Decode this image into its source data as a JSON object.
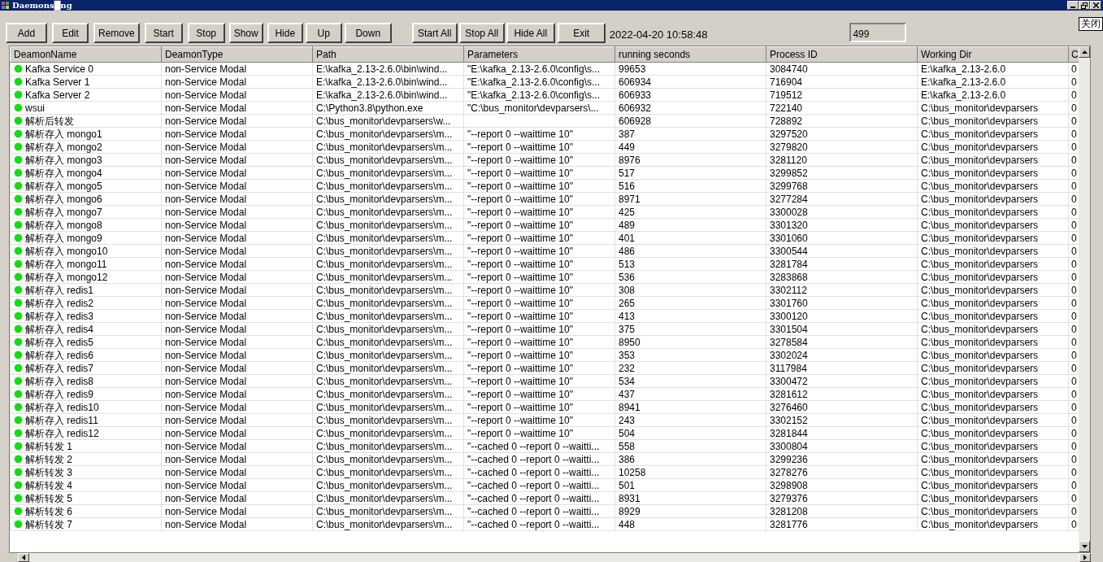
{
  "window": {
    "title": "Daemons█ng"
  },
  "toolbar": {
    "buttons": [
      "Add",
      "Edit",
      "Remove",
      "Start",
      "Stop",
      "Show",
      "Hide",
      "Up",
      "Down"
    ],
    "group_buttons": [
      "Start All",
      "Stop All",
      "Hide All",
      "Exit"
    ],
    "timestamp": "2022-04-20 10:58:48",
    "count_field": "499",
    "close_button": "关闭"
  },
  "table": {
    "columns": [
      "DeamonName",
      "DeamonType",
      "Path",
      "Parameters",
      "running seconds",
      "Process ID",
      "Working Dir",
      "C"
    ],
    "rows": [
      [
        "Kafka Service 0",
        "non-Service Modal",
        "E:\\kafka_2.13-2.6.0\\bin\\wind...",
        "\"E:\\kafka_2.13-2.6.0\\config\\s...",
        "99653",
        "3084740",
        "E:\\kafka_2.13-2.6.0",
        "0"
      ],
      [
        "Kafka Server 1",
        "non-Service Modal",
        "E:\\kafka_2.13-2.6.0\\bin\\wind...",
        "\"E:\\kafka_2.13-2.6.0\\config\\s...",
        "606934",
        "716904",
        "E:\\kafka_2.13-2.6.0",
        "0"
      ],
      [
        "Kafka Server 2",
        "non-Service Modal",
        "E:\\kafka_2.13-2.6.0\\bin\\wind...",
        "\"E:\\kafka_2.13-2.6.0\\config\\s...",
        "606933",
        "719512",
        "E:\\kafka_2.13-2.6.0",
        "0"
      ],
      [
        "wsui",
        "non-Service Modal",
        "C:\\Python3.8\\python.exe",
        "\"C:\\bus_monitor\\devparsers\\...",
        "606932",
        "722140",
        "C:\\bus_monitor\\devparsers",
        "0"
      ],
      [
        "解析后转发",
        "non-Service Modal",
        "C:\\bus_monitor\\devparsers\\w...",
        null,
        "606928",
        "728892",
        "C:\\bus_monitor\\devparsers",
        "0"
      ],
      [
        "解析存入 mongo1",
        "non-Service Modal",
        "C:\\bus_monitor\\devparsers\\m...",
        "\"--report 0 --waittime 10\"",
        "387",
        "3297520",
        "C:\\bus_monitor\\devparsers",
        "0"
      ],
      [
        "解析存入 mongo2",
        "non-Service Modal",
        "C:\\bus_monitor\\devparsers\\m...",
        "\"--report 0 --waittime 10\"",
        "449",
        "3279820",
        "C:\\bus_monitor\\devparsers",
        "0"
      ],
      [
        "解析存入 mongo3",
        "non-Service Modal",
        "C:\\bus_monitor\\devparsers\\m...",
        "\"--report 0 --waittime 10\"",
        "8976",
        "3281120",
        "C:\\bus_monitor\\devparsers",
        "0"
      ],
      [
        "解析存入 mongo4",
        "non-Service Modal",
        "C:\\bus_monitor\\devparsers\\m...",
        "\"--report 0 --waittime 10\"",
        "517",
        "3299852",
        "C:\\bus_monitor\\devparsers",
        "0"
      ],
      [
        "解析存入 mongo5",
        "non-Service Modal",
        "C:\\bus_monitor\\devparsers\\m...",
        "\"--report 0 --waittime 10\"",
        "516",
        "3299768",
        "C:\\bus_monitor\\devparsers",
        "0"
      ],
      [
        "解析存入 mongo6",
        "non-Service Modal",
        "C:\\bus_monitor\\devparsers\\m...",
        "\"--report 0 --waittime 10\"",
        "8971",
        "3277284",
        "C:\\bus_monitor\\devparsers",
        "0"
      ],
      [
        "解析存入 mongo7",
        "non-Service Modal",
        "C:\\bus_monitor\\devparsers\\m...",
        "\"--report 0 --waittime 10\"",
        "425",
        "3300028",
        "C:\\bus_monitor\\devparsers",
        "0"
      ],
      [
        "解析存入 mongo8",
        "non-Service Modal",
        "C:\\bus_monitor\\devparsers\\m...",
        "\"--report 0 --waittime 10\"",
        "489",
        "3301320",
        "C:\\bus_monitor\\devparsers",
        "0"
      ],
      [
        "解析存入 mongo9",
        "non-Service Modal",
        "C:\\bus_monitor\\devparsers\\m...",
        "\"--report 0 --waittime 10\"",
        "401",
        "3301060",
        "C:\\bus_monitor\\devparsers",
        "0"
      ],
      [
        "解析存入 mongo10",
        "non-Service Modal",
        "C:\\bus_monitor\\devparsers\\m...",
        "\"--report 0 --waittime 10\"",
        "486",
        "3300544",
        "C:\\bus_monitor\\devparsers",
        "0"
      ],
      [
        "解析存入 mongo11",
        "non-Service Modal",
        "C:\\bus_monitor\\devparsers\\m...",
        "\"--report 0 --waittime 10\"",
        "513",
        "3281784",
        "C:\\bus_monitor\\devparsers",
        "0"
      ],
      [
        "解析存入 mongo12",
        "non-Service Modal",
        "C:\\bus_monitor\\devparsers\\m...",
        "\"--report 0 --waittime 10\"",
        "536",
        "3283868",
        "C:\\bus_monitor\\devparsers",
        "0"
      ],
      [
        "解析存入 redis1",
        "non-Service Modal",
        "C:\\bus_monitor\\devparsers\\m...",
        "\"--report 0 --waittime 10\"",
        "308",
        "3302112",
        "C:\\bus_monitor\\devparsers",
        "0"
      ],
      [
        "解析存入 redis2",
        "non-Service Modal",
        "C:\\bus_monitor\\devparsers\\m...",
        "\"--report 0 --waittime 10\"",
        "265",
        "3301760",
        "C:\\bus_monitor\\devparsers",
        "0"
      ],
      [
        "解析存入 redis3",
        "non-Service Modal",
        "C:\\bus_monitor\\devparsers\\m...",
        "\"--report 0 --waittime 10\"",
        "413",
        "3300120",
        "C:\\bus_monitor\\devparsers",
        "0"
      ],
      [
        "解析存入 redis4",
        "non-Service Modal",
        "C:\\bus_monitor\\devparsers\\m...",
        "\"--report 0 --waittime 10\"",
        "375",
        "3301504",
        "C:\\bus_monitor\\devparsers",
        "0"
      ],
      [
        "解析存入 redis5",
        "non-Service Modal",
        "C:\\bus_monitor\\devparsers\\m...",
        "\"--report 0 --waittime 10\"",
        "8950",
        "3278584",
        "C:\\bus_monitor\\devparsers",
        "0"
      ],
      [
        "解析存入 redis6",
        "non-Service Modal",
        "C:\\bus_monitor\\devparsers\\m...",
        "\"--report 0 --waittime 10\"",
        "353",
        "3302024",
        "C:\\bus_monitor\\devparsers",
        "0"
      ],
      [
        "解析存入 redis7",
        "non-Service Modal",
        "C:\\bus_monitor\\devparsers\\m...",
        "\"--report 0 --waittime 10\"",
        "232",
        "3117984",
        "C:\\bus_monitor\\devparsers",
        "0"
      ],
      [
        "解析存入 redis8",
        "non-Service Modal",
        "C:\\bus_monitor\\devparsers\\m...",
        "\"--report 0 --waittime 10\"",
        "534",
        "3300472",
        "C:\\bus_monitor\\devparsers",
        "0"
      ],
      [
        "解析存入 redis9",
        "non-Service Modal",
        "C:\\bus_monitor\\devparsers\\m...",
        "\"--report 0 --waittime 10\"",
        "437",
        "3281612",
        "C:\\bus_monitor\\devparsers",
        "0"
      ],
      [
        "解析存入 redis10",
        "non-Service Modal",
        "C:\\bus_monitor\\devparsers\\m...",
        "\"--report 0 --waittime 10\"",
        "8941",
        "3276460",
        "C:\\bus_monitor\\devparsers",
        "0"
      ],
      [
        "解析存入 redis11",
        "non-Service Modal",
        "C:\\bus_monitor\\devparsers\\m...",
        "\"--report 0 --waittime 10\"",
        "243",
        "3302152",
        "C:\\bus_monitor\\devparsers",
        "0"
      ],
      [
        "解析存入 redis12",
        "non-Service Modal",
        "C:\\bus_monitor\\devparsers\\m...",
        "\"--report 0 --waittime 10\"",
        "504",
        "3281844",
        "C:\\bus_monitor\\devparsers",
        "0"
      ],
      [
        "解析转发 1",
        "non-Service Modal",
        "C:\\bus_monitor\\devparsers\\m...",
        "\"--cached 0 --report 0 --waitti...",
        "558",
        "3300804",
        "C:\\bus_monitor\\devparsers",
        "0"
      ],
      [
        "解析转发 2",
        "non-Service Modal",
        "C:\\bus_monitor\\devparsers\\m...",
        "\"--cached 0 --report 0 --waitti...",
        "386",
        "3299236",
        "C:\\bus_monitor\\devparsers",
        "0"
      ],
      [
        "解析转发 3",
        "non-Service Modal",
        "C:\\bus_monitor\\devparsers\\m...",
        "\"--cached 0 --report 0 --waitti...",
        "10258",
        "3278276",
        "C:\\bus_monitor\\devparsers",
        "0"
      ],
      [
        "解析转发 4",
        "non-Service Modal",
        "C:\\bus_monitor\\devparsers\\m...",
        "\"--cached 0 --report 0 --waitti...",
        "501",
        "3298908",
        "C:\\bus_monitor\\devparsers",
        "0"
      ],
      [
        "解析转发 5",
        "non-Service Modal",
        "C:\\bus_monitor\\devparsers\\m...",
        "\"--cached 0 --report 0 --waitti...",
        "8931",
        "3279376",
        "C:\\bus_monitor\\devparsers",
        "0"
      ],
      [
        "解析转发 6",
        "non-Service Modal",
        "C:\\bus_monitor\\devparsers\\m...",
        "\"--cached 0 --report 0 --waitti...",
        "8929",
        "3281208",
        "C:\\bus_monitor\\devparsers",
        "0"
      ],
      [
        "解析转发 7",
        "non-Service Modal",
        "C:\\bus_monitor\\devparsers\\m...",
        "\"--cached 0 --report 0 --waitti...",
        "448",
        "3281776",
        "C:\\bus_monitor\\devparsers",
        "0"
      ]
    ]
  }
}
